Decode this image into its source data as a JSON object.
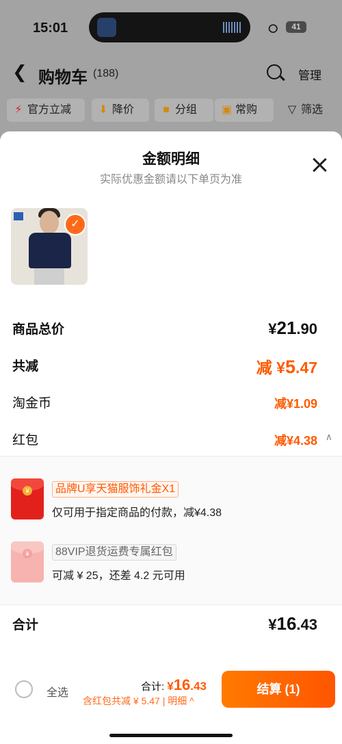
{
  "status_bar": {
    "time": "15:01",
    "battery": "41"
  },
  "nav": {
    "title": "购物车",
    "count": "(188)",
    "manage": "管理"
  },
  "filters": [
    {
      "label": "官方立减",
      "icon": "lightning-icon"
    },
    {
      "label": "降价",
      "icon": "arrow-down-icon"
    },
    {
      "label": "分组",
      "icon": "folder-icon"
    },
    {
      "label": "常购",
      "icon": "cart-icon"
    },
    {
      "label": "筛选",
      "icon": "filter-icon"
    }
  ],
  "sheet": {
    "title": "金额明细",
    "subtitle": "实际优惠金额请以下单页为准"
  },
  "rows": {
    "total_label": "商品总价",
    "total_currency": "¥",
    "total_int": "21",
    "total_dec": ".90",
    "discount_label": "共减",
    "discount_prefix": "减 ¥",
    "discount_int": "5",
    "discount_dec": ".47",
    "coin_label": "淘金币",
    "coin_value": "减¥1.09",
    "redpacket_label": "红包",
    "redpacket_value": "减¥4.38"
  },
  "coupons": [
    {
      "tag": "品牌U享天猫服饰礼金X1",
      "desc": "仅可用于指定商品的付款，减¥4.38"
    },
    {
      "tag": "88VIP退货运费专属红包",
      "desc": "可减 ¥ 25，还差 4.2 元可用"
    }
  ],
  "summary": {
    "label": "合计",
    "currency": "¥",
    "int": "16",
    "dec": ".43"
  },
  "bottom_bar": {
    "select_all": "全选",
    "total_prefix": "合计: ",
    "total_currency": "¥",
    "total_int": "16",
    "total_dec": ".43",
    "note": "含红包共减 ¥ 5.47 | 明细 ^",
    "checkout": "结算 (1)"
  },
  "colors": {
    "accent": "#ff5a00",
    "button": "#ff6a00"
  }
}
